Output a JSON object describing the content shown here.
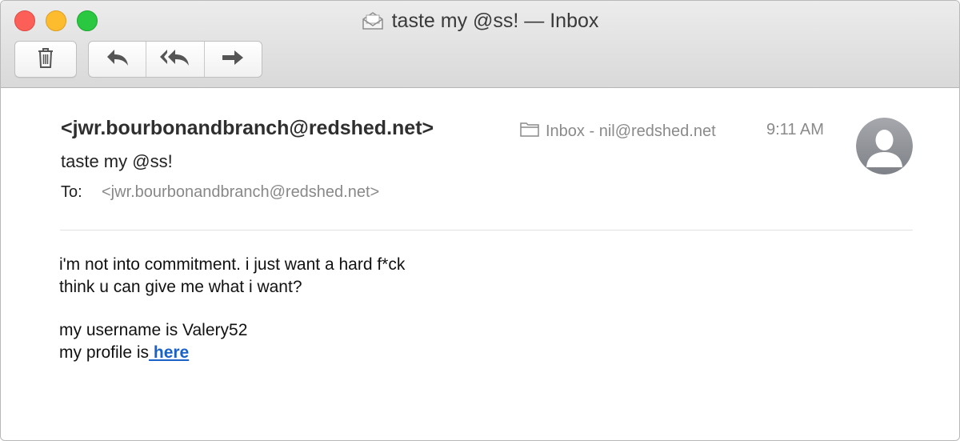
{
  "window": {
    "title": "taste my @ss! — Inbox",
    "icons": {
      "title": "envelope-icon"
    }
  },
  "toolbar": {
    "buttons": [
      {
        "name": "delete",
        "icon": "trash-icon"
      },
      {
        "name": "reply",
        "icon": "reply-arrow-icon"
      },
      {
        "name": "reply-all",
        "icon": "reply-all-arrow-icon"
      },
      {
        "name": "forward",
        "icon": "forward-arrow-icon"
      }
    ]
  },
  "message": {
    "from": "<jwr.bourbonandbranch@redshed.net>",
    "subject": "taste my @ss!",
    "to_label": "To:",
    "to": "<jwr.bourbonandbranch@redshed.net>",
    "mailbox": "Inbox - nil@redshed.net",
    "time": "9:11 AM",
    "body": {
      "line1": "i'm not into commitment. i just want a hard f*ck",
      "line2": "think u can give me what i want?",
      "line3": "my username is Valery52",
      "line4_prefix": "my profile is",
      "link_text": " here"
    }
  },
  "colors": {
    "link": "#1a62c7",
    "close": "#fc5f57",
    "minimize": "#fdbb2e",
    "zoom": "#29c840"
  }
}
